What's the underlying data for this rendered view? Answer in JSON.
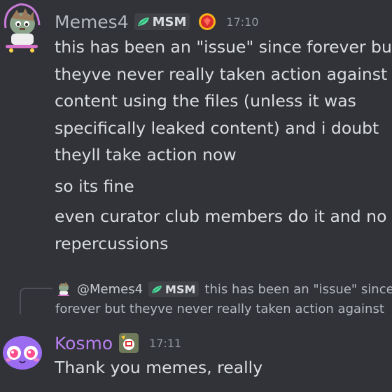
{
  "messages": [
    {
      "author": "Memes4",
      "tag": "MSM",
      "time": "17:10",
      "author_color": "#b4b9c0",
      "paragraphs": [
        {
          "lines": [
            "this has been an \"issue\" since forever but",
            "theyve never really taken action against",
            "content using  the files (unless it was",
            "specifically leaked content) and i doubt",
            "theyll take action now"
          ]
        },
        {
          "lines": [
            "so its fine"
          ]
        },
        {
          "lines": [
            "even curator club members do it and no",
            "repercussions"
          ]
        }
      ],
      "avatar_icon": "cartoon-avatar-icon",
      "badge_icon": "red-gem-badge-icon"
    },
    {
      "reply": {
        "author": "@Memes4",
        "tag": "MSM",
        "line1": "this has been an \"issue\" since",
        "line2": "forever but theyve never really taken action against"
      },
      "author": "Kosmo",
      "time": "17:11",
      "author_color": "#b77ff0",
      "text": "Thank you memes, really",
      "avatar_icon": "purple-creature-avatar-icon",
      "badge_icon": "server-badge-icon"
    }
  ],
  "colors": {
    "background": "#313338",
    "text": "#dbdee1",
    "muted": "#949ba4",
    "tag_bg": "#3f4147",
    "tag_leaf": "#4fdc9c"
  }
}
